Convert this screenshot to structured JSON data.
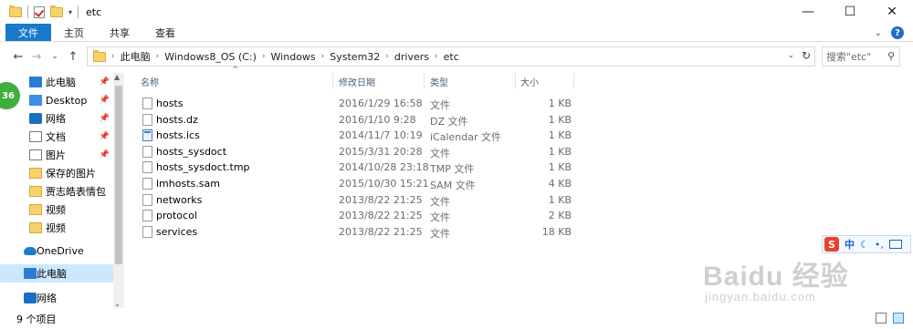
{
  "window": {
    "title": "etc",
    "controls": {
      "minimize": "—",
      "maximize": "☐",
      "close": "✕"
    }
  },
  "ribbon": {
    "tabs": [
      "文件",
      "主页",
      "共享",
      "查看"
    ],
    "expand": "⌄",
    "help": "?"
  },
  "nav": {
    "back": "←",
    "forward": "→",
    "recent": "⌄",
    "up": "↑"
  },
  "address": {
    "crumbs": [
      "此电脑",
      "Windows8_OS (C:)",
      "Windows",
      "System32",
      "drivers",
      "etc"
    ],
    "dropdown": "⌄",
    "refresh": "↻"
  },
  "search": {
    "placeholder": "搜索\"etc\"",
    "icon": "search-icon"
  },
  "sidebar": {
    "items": [
      {
        "label": "此电脑",
        "icon": "computer-icon",
        "pinned": true
      },
      {
        "label": "Desktop",
        "icon": "desktop-icon",
        "pinned": true
      },
      {
        "label": "网络",
        "icon": "network-icon",
        "pinned": true
      },
      {
        "label": "文档",
        "icon": "document-icon",
        "pinned": true
      },
      {
        "label": "图片",
        "icon": "picture-icon",
        "pinned": true
      },
      {
        "label": "保存的图片",
        "icon": "folder-icon",
        "pinned": false
      },
      {
        "label": "贾志皓表情包",
        "icon": "folder-icon",
        "pinned": false
      },
      {
        "label": "视频",
        "icon": "folder-icon",
        "pinned": false
      },
      {
        "label": "视频",
        "icon": "folder-icon",
        "pinned": false
      },
      {
        "label": "OneDrive",
        "icon": "cloud-icon",
        "pinned": false
      },
      {
        "label": "此电脑",
        "icon": "computer-icon",
        "pinned": false,
        "selected": true
      },
      {
        "label": "网络",
        "icon": "network-icon",
        "pinned": false
      }
    ]
  },
  "badge": "36",
  "columns": {
    "name": "名称",
    "date": "修改日期",
    "type": "类型",
    "size": "大小"
  },
  "files": [
    {
      "name": "hosts",
      "date": "2016/1/29 16:58",
      "type": "文件",
      "size": "1 KB",
      "icon": "file-icon"
    },
    {
      "name": "hosts.dz",
      "date": "2016/1/10 9:28",
      "type": "DZ 文件",
      "size": "1 KB",
      "icon": "file-icon"
    },
    {
      "name": "hosts.ics",
      "date": "2014/11/7 10:19",
      "type": "iCalendar 文件",
      "size": "1 KB",
      "icon": "calendar-file-icon"
    },
    {
      "name": "hosts_sysdoct",
      "date": "2015/3/31 20:28",
      "type": "文件",
      "size": "1 KB",
      "icon": "file-icon"
    },
    {
      "name": "hosts_sysdoct.tmp",
      "date": "2014/10/28 23:18",
      "type": "TMP 文件",
      "size": "1 KB",
      "icon": "file-icon"
    },
    {
      "name": "lmhosts.sam",
      "date": "2015/10/30 15:21",
      "type": "SAM 文件",
      "size": "4 KB",
      "icon": "file-icon"
    },
    {
      "name": "networks",
      "date": "2013/8/22 21:25",
      "type": "文件",
      "size": "1 KB",
      "icon": "file-icon"
    },
    {
      "name": "protocol",
      "date": "2013/8/22 21:25",
      "type": "文件",
      "size": "2 KB",
      "icon": "file-icon"
    },
    {
      "name": "services",
      "date": "2013/8/22 21:25",
      "type": "文件",
      "size": "18 KB",
      "icon": "file-icon"
    }
  ],
  "status": {
    "count": "9 个项目"
  },
  "ime": {
    "logo": "S",
    "lang": "中"
  },
  "watermark": {
    "text": "Baidu 经验",
    "sub": "jingyan.baidu.com"
  }
}
